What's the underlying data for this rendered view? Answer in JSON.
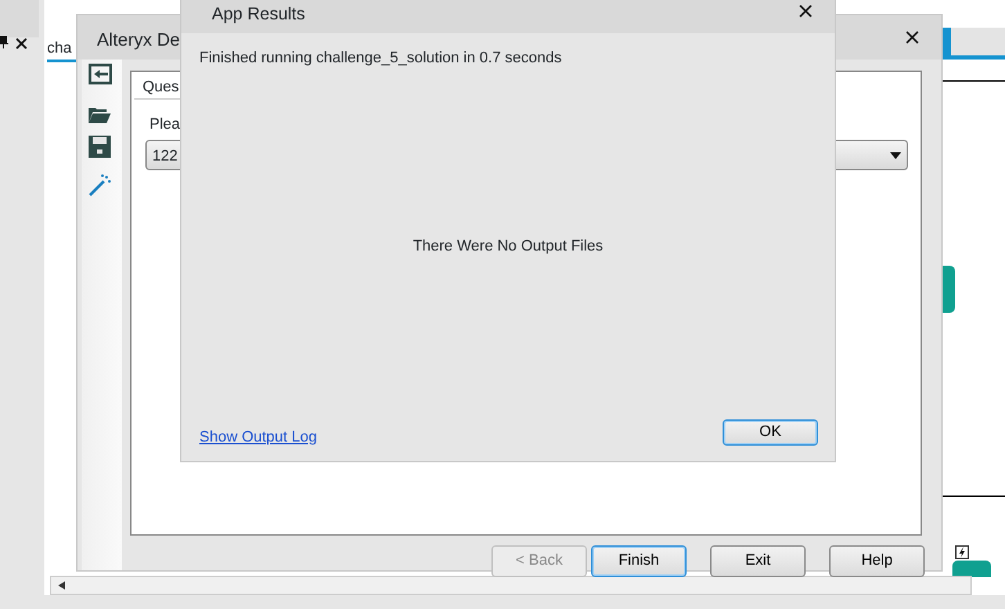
{
  "background_app": {
    "tab": {
      "label": "cha",
      "selected": true
    }
  },
  "designer_window": {
    "title": "Alteryx De",
    "tab": "Ques",
    "prompt": "Plea",
    "dropdown_value": "122",
    "buttons": [
      {
        "label": "< Back",
        "disabled": true,
        "default": false
      },
      {
        "label": "Finish",
        "disabled": false,
        "default": true
      },
      {
        "label": "Exit",
        "disabled": false,
        "default": false
      },
      {
        "label": "Help",
        "disabled": false,
        "default": false
      }
    ]
  },
  "results_dialog": {
    "title": "App Results",
    "message": "Finished running challenge_5_solution in 0.7 seconds",
    "status": "There Were No Output Files",
    "link": "Show Output Log",
    "button": "OK"
  }
}
